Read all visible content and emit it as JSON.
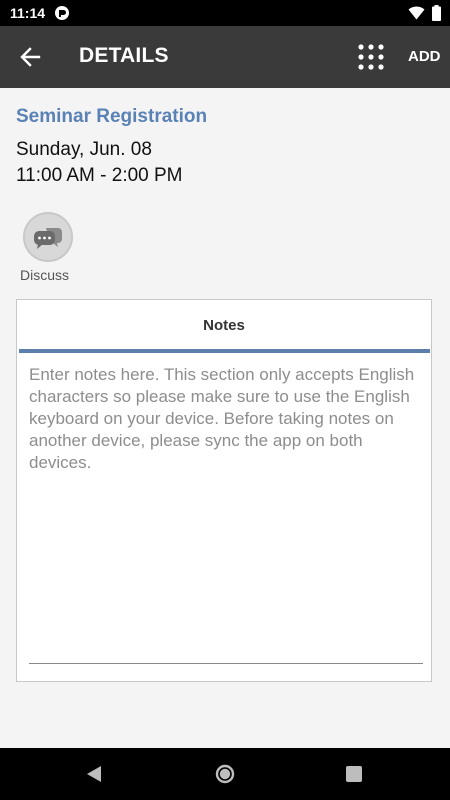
{
  "status_bar": {
    "time": "11:14",
    "app_icon": "pocket-icon",
    "wifi_icon": "wifi-icon",
    "battery_icon": "battery-icon"
  },
  "app_bar": {
    "back_icon": "arrow-left-icon",
    "title": "DETAILS",
    "grid_icon": "grid-dots-icon",
    "add_label": "ADD"
  },
  "event": {
    "title": "Seminar Registration",
    "date": "Sunday, Jun. 08",
    "time": "11:00 AM - 2:00 PM"
  },
  "discuss": {
    "icon": "chat-bubbles-icon",
    "label": "Discuss"
  },
  "notes": {
    "header": "Notes",
    "value": "",
    "placeholder": "Enter notes here. This section only accepts English characters so please make sure to use the English keyboard on your device. Before taking notes on another device, please sync the app on both devices."
  },
  "nav_bar": {
    "back_icon": "triangle-back-icon",
    "home_icon": "circle-home-icon",
    "recents_icon": "square-recents-icon"
  },
  "colors": {
    "accent": "#5a82b6",
    "app_bar": "#3a3a3a",
    "background": "#f4f4f4"
  }
}
